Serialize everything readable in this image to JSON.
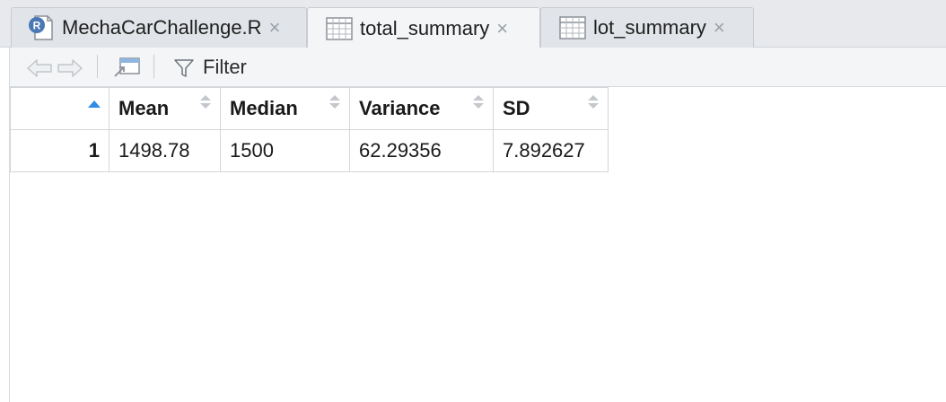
{
  "tabs": [
    {
      "label": "MechaCarChallenge.R",
      "icon": "r-script-icon",
      "active": false
    },
    {
      "label": "total_summary",
      "icon": "table-grid-icon",
      "active": true
    },
    {
      "label": "lot_summary",
      "icon": "table-grid-icon",
      "active": false
    }
  ],
  "toolbar": {
    "filter_label": "Filter"
  },
  "table": {
    "columns": [
      "",
      "Mean",
      "Median",
      "Variance",
      "SD"
    ],
    "rows": [
      [
        "1",
        "1498.78",
        "1500",
        "62.29356",
        "7.892627"
      ]
    ]
  },
  "colors": {
    "accent": "#2f8be6",
    "tab_bar": "#e7e9ec",
    "active_tab": "#f4f5f6",
    "r_badge": "#4a78b5"
  }
}
